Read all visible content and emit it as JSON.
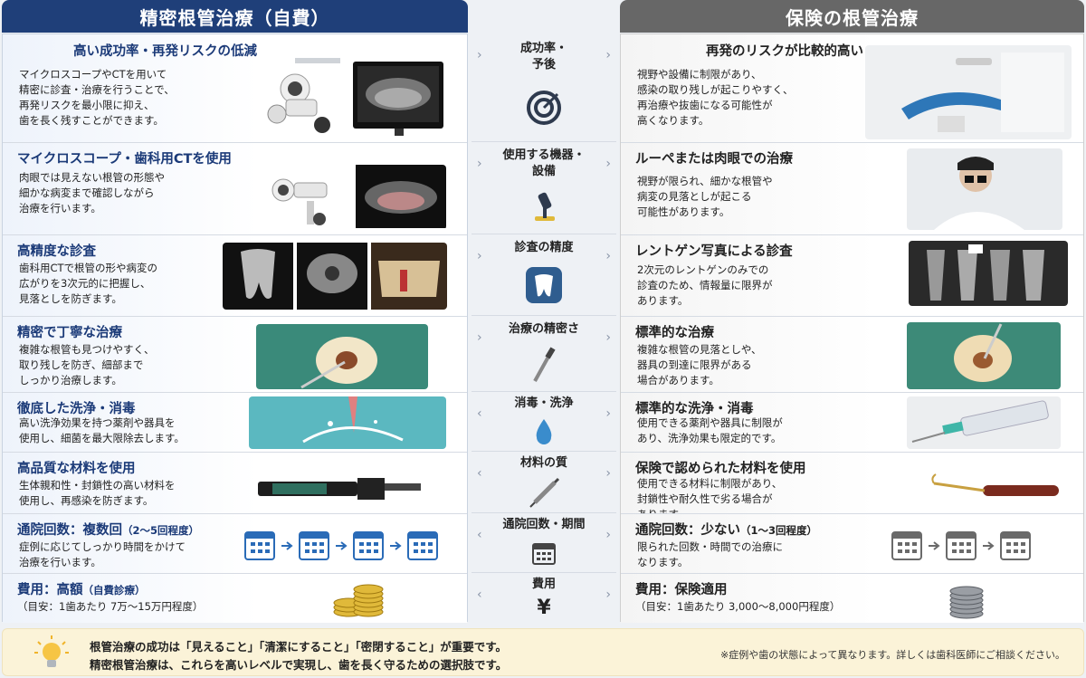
{
  "headers": {
    "left": "精密根管治療（自費）",
    "right": "保険の根管治療"
  },
  "rows": [
    {
      "middle": "成功率・\n予後",
      "left": {
        "title": "高い成功率・再発リスクの低減",
        "desc": "マイクロスコープやCTを用いて\n精密に診査・治療を行うことで、\n再発リスクを最小限に抑え、\n歯を長く残すことができます。"
      },
      "right": {
        "title": "再発のリスクが比較的高い",
        "desc": "視野や設備に制限があり、\n感染の取り残しが起こりやすく、\n再治療や抜歯になる可能性が\n高くなります。"
      }
    },
    {
      "middle": "使用する機器・\n設備",
      "left": {
        "title": "マイクロスコープ・歯科用CTを使用",
        "desc": "肉眼では見えない根管の形態や\n細かな病変まで確認しながら\n治療を行います。"
      },
      "right": {
        "title": "ルーペまたは肉眼での治療",
        "desc": "視野が限られ、細かな根管や\n病変の見落としが起こる\n可能性があります。"
      }
    },
    {
      "middle": "診査の精度",
      "left": {
        "title": "高精度な診査",
        "desc": "歯科用CTで根管の形や病変の\n広がりを3次元的に把握し、\n見落としを防ぎます。"
      },
      "right": {
        "title": "レントゲン写真による診査",
        "desc": "2次元のレントゲンのみでの\n診査のため、情報量に限界が\nあります。"
      }
    },
    {
      "middle": "治療の精密さ",
      "left": {
        "title": "精密で丁寧な治療",
        "desc": "複雑な根管も見つけやすく、\n取り残しを防ぎ、細部まで\nしっかり治療します。"
      },
      "right": {
        "title": "標準的な治療",
        "desc": "複雑な根管の見落としや、\n器具の到達に限界がある\n場合があります。"
      }
    },
    {
      "middle": "消毒・洗浄",
      "left": {
        "title": "徹底した洗浄・消毒",
        "desc": "高い洗浄効果を持つ薬剤や器具を\n使用し、細菌を最大限除去します。"
      },
      "right": {
        "title": "標準的な洗浄・消毒",
        "desc": "使用できる薬剤や器具に制限が\nあり、洗浄効果も限定的です。"
      }
    },
    {
      "middle": "材料の質",
      "left": {
        "title": "高品質な材料を使用",
        "desc": "生体親和性・封鎖性の高い材料を\n使用し、再感染を防ぎます。"
      },
      "right": {
        "title": "保険で認められた材料を使用",
        "desc": "使用できる材料に制限があり、\n封鎖性や耐久性で劣る場合が\nあります。"
      }
    },
    {
      "middle": "通院回数・期間",
      "left": {
        "title": "通院回数：複数回",
        "title_small": "（2〜5回程度）",
        "desc": "症例に応じてしっかり時間をかけて\n治療を行います。"
      },
      "right": {
        "title": "通院回数：少ない",
        "title_small": "（1〜3回程度）",
        "desc": "限られた回数・時間での治療に\nなります。"
      }
    },
    {
      "middle": "費用",
      "left": {
        "title": "費用：高額",
        "title_small": "（自費診療）",
        "desc": "（目安：1歯あたり  7万〜15万円程度）"
      },
      "right": {
        "title": "費用：保険適用",
        "desc": "（目安：1歯あたり  3,000〜8,000円程度）"
      }
    }
  ],
  "currency_symbol": "¥",
  "footer": {
    "line1": "根管治療の成功は「見えること」「清潔にすること」「密閉すること」が重要です。",
    "line2": "精密根管治療は、これらを高いレベルで実現し、歯を長く守るための選択肢です。",
    "note": "※症例や歯の状態によって異なります。詳しくは歯科医師にご相談ください。"
  },
  "colors": {
    "left_header": "#1f3f79",
    "right_header": "#676767",
    "accent_blue": "#2a6bb7",
    "footer_bg": "#fbf3d8"
  }
}
